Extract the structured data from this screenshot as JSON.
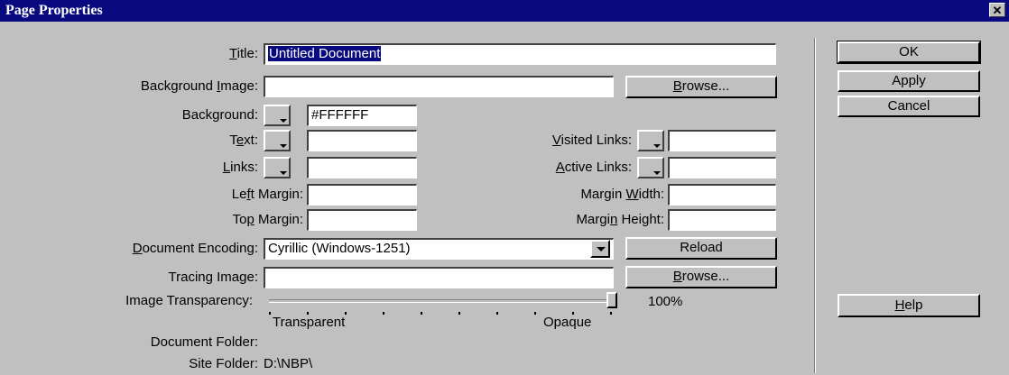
{
  "window": {
    "title": "Page Properties",
    "close_glyph": "✕"
  },
  "form": {
    "title_label": "Title:",
    "title_value": "Untitled Document",
    "bg_image_label": "Background Image:",
    "bg_image_value": "",
    "browse_label": "Browse...",
    "background_label": "Background:",
    "background_value": "#FFFFFF",
    "text_label": "Text:",
    "text_value": "",
    "visited_links_label": "Visited Links:",
    "visited_links_value": "",
    "links_label": "Links:",
    "links_value": "",
    "active_links_label": "Active Links:",
    "active_links_value": "",
    "left_margin_label": "Left Margin:",
    "left_margin_value": "",
    "margin_width_label": "Margin Width:",
    "margin_width_value": "",
    "top_margin_label": "Top Margin:",
    "top_margin_value": "",
    "margin_height_label": "Margin Height:",
    "margin_height_value": "",
    "encoding_label": "Document Encoding:",
    "encoding_value": "Cyrillic (Windows-1251)",
    "reload_label": "Reload",
    "tracing_image_label": "Tracing Image:",
    "tracing_image_value": "",
    "tracing_browse_label": "Browse...",
    "transparency_label": "Image Transparency:",
    "transparency_value": "100%",
    "transparency_level": 1.0,
    "transparent_label": "Transparent",
    "opaque_label": "Opaque",
    "doc_folder_label": "Document Folder:",
    "doc_folder_value": "",
    "site_folder_label": "Site Folder:",
    "site_folder_value": "D:\\NBP\\"
  },
  "buttons": {
    "ok": "OK",
    "apply": "Apply",
    "cancel": "Cancel",
    "help": "Help"
  },
  "colors": {
    "dialog_bg": "#c0c0c0",
    "titlebar": "#0a0a80",
    "selection": "#0a0a80"
  }
}
